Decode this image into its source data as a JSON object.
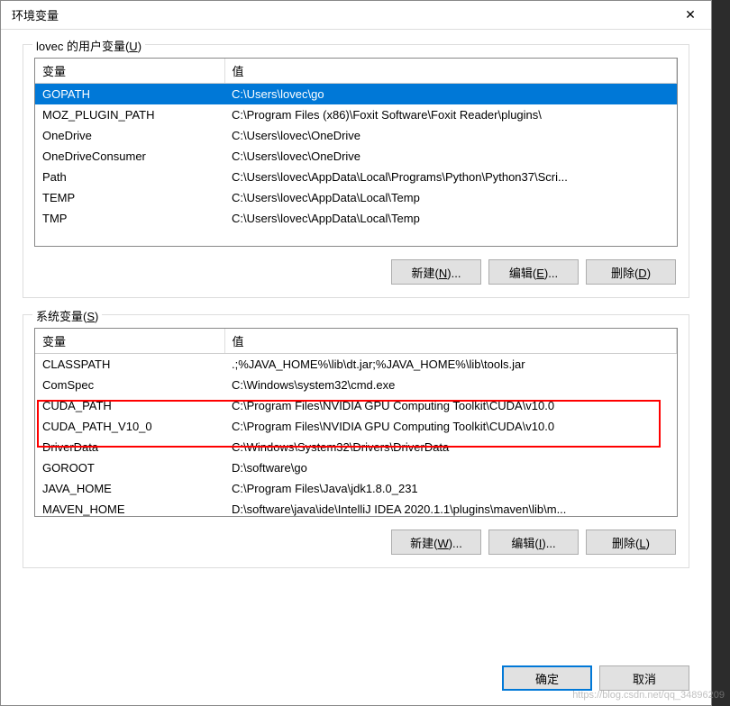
{
  "dialog": {
    "title": "环境变量",
    "close_label": "✕"
  },
  "user_section": {
    "legend": "lovec 的用户变量(U)",
    "legend_key": "U",
    "headers": {
      "var": "变量",
      "val": "值"
    },
    "rows": [
      {
        "var": "GOPATH",
        "val": "C:\\Users\\lovec\\go",
        "selected": true
      },
      {
        "var": "MOZ_PLUGIN_PATH",
        "val": "C:\\Program Files (x86)\\Foxit Software\\Foxit Reader\\plugins\\"
      },
      {
        "var": "OneDrive",
        "val": "C:\\Users\\lovec\\OneDrive"
      },
      {
        "var": "OneDriveConsumer",
        "val": "C:\\Users\\lovec\\OneDrive"
      },
      {
        "var": "Path",
        "val": "C:\\Users\\lovec\\AppData\\Local\\Programs\\Python\\Python37\\Scri..."
      },
      {
        "var": "TEMP",
        "val": "C:\\Users\\lovec\\AppData\\Local\\Temp"
      },
      {
        "var": "TMP",
        "val": "C:\\Users\\lovec\\AppData\\Local\\Temp"
      }
    ],
    "buttons": {
      "new": "新建(N)...",
      "edit": "编辑(E)...",
      "delete": "删除(D)"
    }
  },
  "system_section": {
    "legend": "系统变量(S)",
    "legend_key": "S",
    "headers": {
      "var": "变量",
      "val": "值"
    },
    "rows": [
      {
        "var": "CLASSPATH",
        "val": ".;%JAVA_HOME%\\lib\\dt.jar;%JAVA_HOME%\\lib\\tools.jar"
      },
      {
        "var": "ComSpec",
        "val": "C:\\Windows\\system32\\cmd.exe"
      },
      {
        "var": "CUDA_PATH",
        "val": "C:\\Program Files\\NVIDIA GPU Computing Toolkit\\CUDA\\v10.0",
        "highlighted": true
      },
      {
        "var": "CUDA_PATH_V10_0",
        "val": "C:\\Program Files\\NVIDIA GPU Computing Toolkit\\CUDA\\v10.0",
        "highlighted": true
      },
      {
        "var": "DriverData",
        "val": "C:\\Windows\\System32\\Drivers\\DriverData"
      },
      {
        "var": "GOROOT",
        "val": "D:\\software\\go"
      },
      {
        "var": "JAVA_HOME",
        "val": "C:\\Program Files\\Java\\jdk1.8.0_231"
      },
      {
        "var": "MAVEN_HOME",
        "val": "D:\\software\\java\\ide\\IntelliJ IDEA 2020.1.1\\plugins\\maven\\lib\\m..."
      }
    ],
    "buttons": {
      "new": "新建(W)...",
      "edit": "编辑(I)...",
      "delete": "删除(L)"
    }
  },
  "dialog_buttons": {
    "ok": "确定",
    "cancel": "取消"
  },
  "watermark": "https://blog.csdn.net/qq_34896209"
}
